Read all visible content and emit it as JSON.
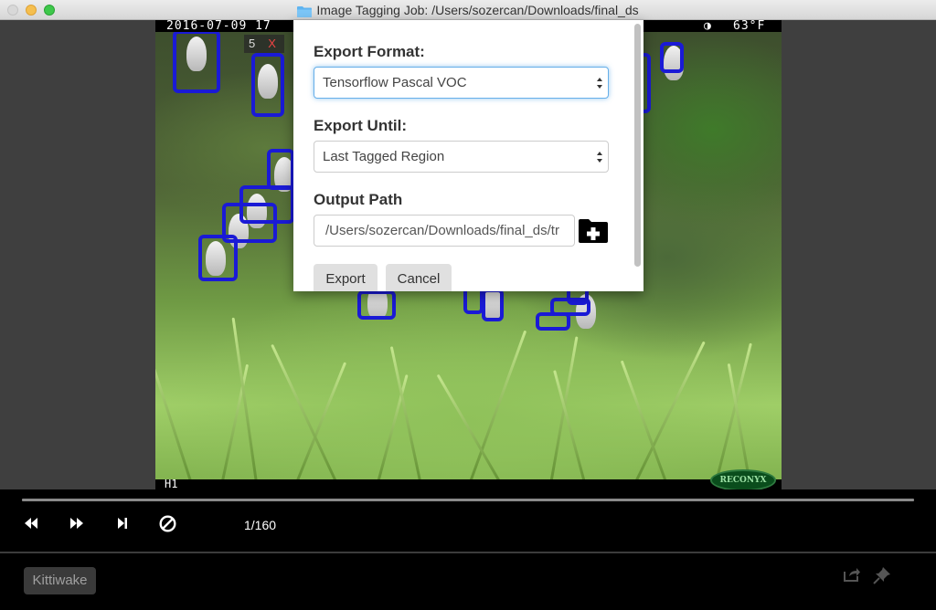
{
  "window": {
    "title": "Image Tagging Job: /Users/sozercan/Downloads/final_ds"
  },
  "camera": {
    "date": "2016-07-09 17",
    "temperature": "63°F",
    "moon": "◑",
    "camera_id": "H1",
    "brand": "RECONYX"
  },
  "region_badge": {
    "number": "5",
    "delete": "X"
  },
  "export_dialog": {
    "format_label": "Export Format:",
    "format_value": "Tensorflow Pascal VOC",
    "until_label": "Export Until:",
    "until_value": "Last Tagged Region",
    "path_label": "Output Path",
    "path_value": "/Users/sozercan/Downloads/final_ds/tr",
    "export_button": "Export",
    "cancel_button": "Cancel"
  },
  "player": {
    "counter": "1/160",
    "controls": [
      "rewind-icon",
      "fast-forward-icon",
      "skip-to-end-icon",
      "clear-icon"
    ]
  },
  "tags": [
    "Kittiwake"
  ],
  "colors": {
    "bounding_box": "#1a1ad6",
    "focus": "#66afe9"
  }
}
